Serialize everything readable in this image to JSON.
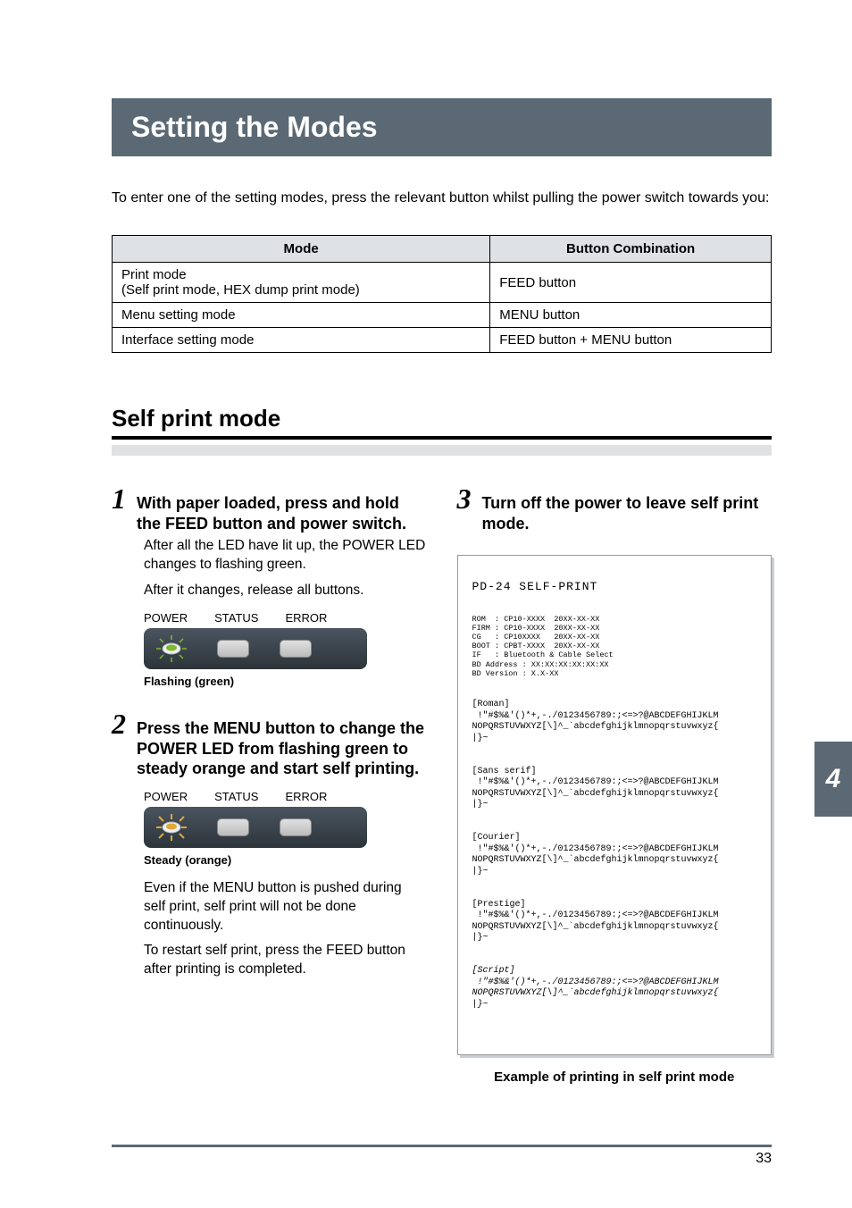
{
  "title": "Setting the Modes",
  "intro": "To enter one of the setting modes, press the relevant button whilst pulling the power switch towards you:",
  "table": {
    "headers": [
      "Mode",
      "Button Combination"
    ],
    "rows": [
      [
        "Print mode\n(Self print mode, HEX dump print mode)",
        "FEED button"
      ],
      [
        "Menu setting mode",
        "MENU button"
      ],
      [
        "Interface setting mode",
        "FEED button + MENU button"
      ]
    ]
  },
  "section": "Self print mode",
  "steps": {
    "s1": {
      "num": "1",
      "title": "With paper loaded, press and hold the FEED button and power switch.",
      "body1": "After all the LED have lit up, the POWER LED changes to flashing green.",
      "body2": "After it changes, release all buttons.",
      "caption": "Flashing (green)"
    },
    "s2": {
      "num": "2",
      "title": "Press the MENU button to change the POWER LED from flashing green to steady orange and start self printing.",
      "caption": "Steady (orange)",
      "body1": "Even if the MENU button is pushed during self print, self print will not be done continuously.",
      "body2": "To restart self print, press the FEED button after printing is completed."
    },
    "s3": {
      "num": "3",
      "title": "Turn off the power to leave self print mode."
    }
  },
  "led_labels": {
    "power": "POWER",
    "status": "STATUS",
    "error": "ERROR"
  },
  "selfprint": {
    "title": "PD-24 SELF-PRINT",
    "meta": "ROM  : CP10-XXXX  20XX-XX-XX\nFIRM : CP10-XXXX  20XX-XX-XX\nCG   : CP10XXXX   20XX-XX-XX\nBOOT : CPBT-XXXX  20XX-XX-XX\nIF   : Bluetooth & Cable Select\nBD Address : XX:XX:XX:XX:XX:XX\nBD Version : X.X-XX",
    "fonts": [
      {
        "name": "[Roman]",
        "italic": false
      },
      {
        "name": "[Sans serif]",
        "italic": false
      },
      {
        "name": "[Courier]",
        "italic": false
      },
      {
        "name": "[Prestige]",
        "italic": false
      },
      {
        "name": "[Script]",
        "italic": true
      }
    ],
    "line1": " !\"#$%&'()*+,-./0123456789:;<=>?@ABCDEFGHIJKLM",
    "line2": "NOPQRSTUVWXYZ[\\]^_`abcdefghijklmnopqrstuvwxyz{",
    "line3": "|}~",
    "example_caption": "Example of printing in self print mode"
  },
  "side_tab": "4",
  "page_number": "33"
}
